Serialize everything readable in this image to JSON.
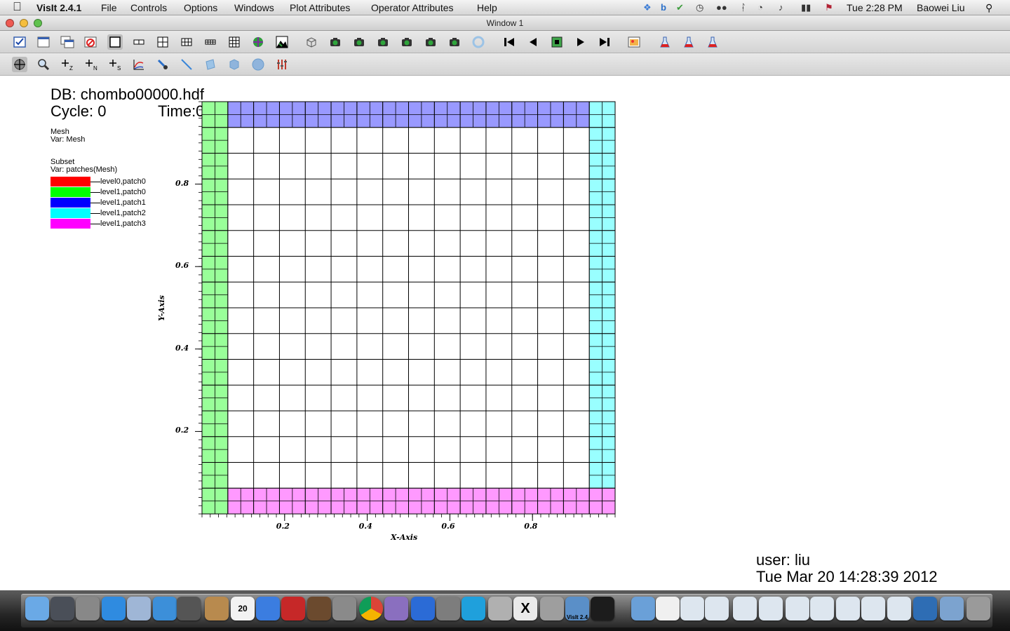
{
  "menubar": {
    "app_name": "VisIt 2.4.1",
    "items": [
      "File",
      "Controls",
      "Options",
      "Windows",
      "Plot Attributes",
      "Operator Attributes",
      "Help"
    ],
    "clock": "Tue 2:28 PM",
    "user": "Baowei Liu"
  },
  "window": {
    "title": "Window 1"
  },
  "toolbar1": {
    "icons": [
      "clear-all-icon",
      "new-window-icon",
      "clone-window-icon",
      "delete-window-icon",
      "layout-1x1-icon",
      "layout-1x2-icon",
      "layout-2x2-icon",
      "layout-2x3-icon",
      "layout-2x4-icon",
      "layout-3x3-icon",
      "invert-background-icon",
      "set-mode-icon",
      "view-3d-icon",
      "lock-view-icon",
      "lock-time-icon",
      "lock-tools-icon",
      "camera-icon",
      "save-image-icon",
      "spin-icon",
      "reset-view-icon",
      "step-back-end-icon",
      "step-back-icon",
      "stop-icon",
      "play-icon",
      "step-forward-end-icon",
      "pick-icon",
      "lineout-icon",
      "lineout2-icon",
      "lineout3-icon"
    ]
  },
  "toolbar2": {
    "icons": [
      "navigate-icon",
      "zoom-icon",
      "zone-pick-icon",
      "node-pick-icon",
      "spreadsheet-pick-icon",
      "lineout-curve-icon",
      "point-tool-icon",
      "line-tool-icon",
      "plane-tool-icon",
      "box-tool-icon",
      "sphere-tool-icon",
      "axis-restrict-icon"
    ]
  },
  "annotations": {
    "db": "DB: chombo00000.hdf",
    "cycle": "Cycle: 0",
    "time": "Time:0",
    "user": "user: liu",
    "date": "Tue Mar 20 14:28:39 2012"
  },
  "legend": {
    "mesh_title": "Mesh",
    "mesh_var": "Var: Mesh",
    "subset_title": "Subset",
    "subset_var": "Var: patches(Mesh)",
    "entries": [
      {
        "label": "level0,patch0",
        "color": "#ff0000"
      },
      {
        "label": "level1,patch0",
        "color": "#00ff00"
      },
      {
        "label": "level1,patch1",
        "color": "#0000ff"
      },
      {
        "label": "level1,patch2",
        "color": "#00ffff"
      },
      {
        "label": "level1,patch3",
        "color": "#ff00ff"
      }
    ]
  },
  "chart_data": {
    "type": "heatmap",
    "title": "",
    "xlabel": "X-Axis",
    "ylabel": "Y-Axis",
    "xlim": [
      0,
      1
    ],
    "ylim": [
      0,
      1
    ],
    "x_ticks": [
      0.2,
      0.4,
      0.6,
      0.8
    ],
    "y_ticks": [
      0.2,
      0.4,
      0.6,
      0.8
    ],
    "x_tick_labels": [
      "0.2",
      "0.4",
      "0.6",
      "0.8"
    ],
    "y_tick_labels": [
      "0.2",
      "0.4",
      "0.6",
      "0.8"
    ],
    "coarse_cells": 16,
    "fine_cells": 32,
    "patches": [
      {
        "name": "level1,patch0",
        "x": [
          0,
          0.0625
        ],
        "y": [
          0,
          1
        ],
        "color": "#99ff99"
      },
      {
        "name": "level1,patch1",
        "x": [
          0.0625,
          0.9375
        ],
        "y": [
          0.9375,
          1
        ],
        "color": "#9999ff"
      },
      {
        "name": "level1,patch2",
        "x": [
          0.9375,
          1
        ],
        "y": [
          0,
          1
        ],
        "color": "#99ffff"
      },
      {
        "name": "level1,patch3",
        "x": [
          0.0625,
          1
        ],
        "y": [
          0,
          0.0625
        ],
        "color": "#ff99ff"
      }
    ]
  },
  "dock": {
    "items": [
      "finder",
      "launchpad",
      "system-profiler",
      "app-store",
      "preview",
      "safari",
      "camera",
      "contacts",
      "calendar",
      "itunes",
      "photo-booth",
      "iphoto",
      "system-preferences",
      "chrome",
      "mail",
      "word",
      "utilities",
      "skype",
      "preview-2",
      "x11",
      "calculator",
      "visit",
      "terminal",
      "folder",
      "document",
      "window-1",
      "window-2",
      "window-3",
      "window-4",
      "window-5",
      "window-6",
      "window-7",
      "window-8",
      "window-9",
      "window-10",
      "window-11",
      "trash"
    ],
    "calendar_day": "20",
    "visit_label": "VisIt 2.4"
  }
}
